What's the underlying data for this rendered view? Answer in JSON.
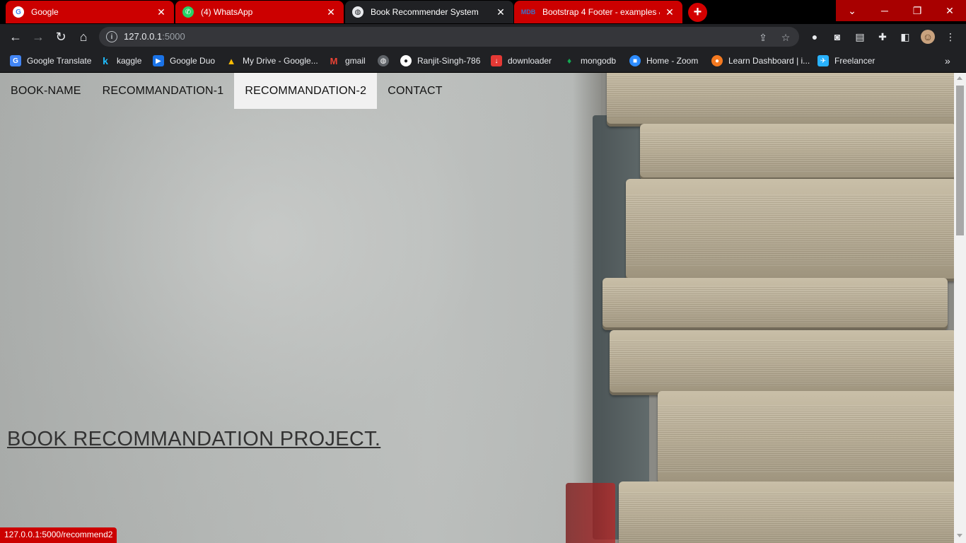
{
  "tabs": [
    {
      "title": "Google",
      "favicon": "google-icon",
      "active": false
    },
    {
      "title": "(4) WhatsApp",
      "favicon": "whatsapp-icon",
      "active": false
    },
    {
      "title": "Book Recommender System",
      "favicon": "globe-icon",
      "active": true
    },
    {
      "title": "Bootstrap 4 Footer - examples &",
      "favicon": "mdb-icon",
      "active": false
    }
  ],
  "toolbar": {
    "url_host": "127.0.0.1",
    "url_port": ":5000"
  },
  "bookmarks": [
    {
      "label": "Google Translate",
      "icon": "google-translate-icon",
      "color": "#4285f4",
      "glyph": "G"
    },
    {
      "label": "kaggle",
      "icon": "kaggle-icon",
      "color": "#20beff",
      "glyph": "k"
    },
    {
      "label": "Google Duo",
      "icon": "google-duo-icon",
      "color": "#1a73e8",
      "glyph": "▶"
    },
    {
      "label": "My Drive - Google...",
      "icon": "google-drive-icon",
      "color": "#fbbc04",
      "glyph": "▲"
    },
    {
      "label": "gmail",
      "icon": "gmail-icon",
      "color": "#ea4335",
      "glyph": "M"
    },
    {
      "label": "",
      "icon": "globe-icon",
      "color": "#5f6368",
      "glyph": "◍"
    },
    {
      "label": "Ranjit-Singh-786",
      "icon": "github-icon",
      "color": "#202124",
      "glyph": "●"
    },
    {
      "label": "downloader",
      "icon": "downloader-icon",
      "color": "#e53935",
      "glyph": "↓"
    },
    {
      "label": "mongodb",
      "icon": "mongodb-icon",
      "color": "#13aa52",
      "glyph": "●"
    },
    {
      "label": "Home - Zoom",
      "icon": "zoom-icon",
      "color": "#2d8cff",
      "glyph": "■"
    },
    {
      "label": "Learn Dashboard | i...",
      "icon": "learn-dashboard-icon",
      "color": "#f47920",
      "glyph": "●"
    },
    {
      "label": "Freelancer",
      "icon": "freelancer-icon",
      "color": "#29b2fe",
      "glyph": "✈"
    }
  ],
  "page": {
    "nav": [
      {
        "label": "BOOK-NAME",
        "active": false
      },
      {
        "label": "RECOMMANDATION-1",
        "active": false
      },
      {
        "label": "RECOMMANDATION-2",
        "active": true
      },
      {
        "label": "CONTACT",
        "active": false
      }
    ],
    "headline": "BOOK RECOMMANDATION PROJECT."
  },
  "status": {
    "link_url": "127.0.0.1:5000/recommend2"
  },
  "colors": {
    "tab_inactive": "#cc0000",
    "tab_active": "#202124",
    "chrome_toolbar": "#202124",
    "nav_active_bg": "#f1f1f1"
  }
}
